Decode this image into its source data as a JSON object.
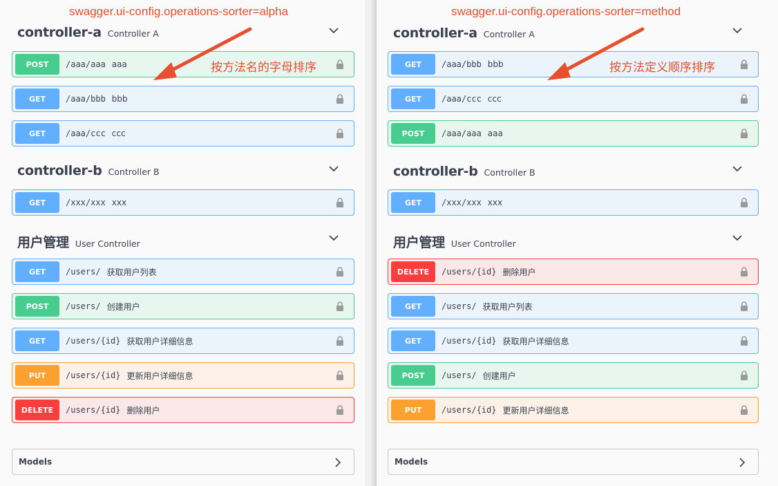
{
  "left": {
    "sorter_label": "swagger.ui-config.operations-sorter=alpha",
    "arrow_label": "按方法名的字母排序",
    "tags": [
      {
        "name": "controller-a",
        "description": "Controller A",
        "operations": [
          {
            "method": "POST",
            "path": "/aaa/aaa",
            "summary": "aaa"
          },
          {
            "method": "GET",
            "path": "/aaa/bbb",
            "summary": "bbb"
          },
          {
            "method": "GET",
            "path": "/aaa/ccc",
            "summary": "ccc"
          }
        ]
      },
      {
        "name": "controller-b",
        "description": "Controller B",
        "operations": [
          {
            "method": "GET",
            "path": "/xxx/xxx",
            "summary": "xxx"
          }
        ]
      },
      {
        "name": "用户管理",
        "description": "User Controller",
        "operations": [
          {
            "method": "GET",
            "path": "/users/",
            "summary": "获取用户列表"
          },
          {
            "method": "POST",
            "path": "/users/",
            "summary": "创建用户"
          },
          {
            "method": "GET",
            "path": "/users/{id}",
            "summary": "获取用户详细信息"
          },
          {
            "method": "PUT",
            "path": "/users/{id}",
            "summary": "更新用户详细信息"
          },
          {
            "method": "DELETE",
            "path": "/users/{id}",
            "summary": "删除用户"
          }
        ]
      }
    ],
    "models_label": "Models"
  },
  "right": {
    "sorter_label": "swagger.ui-config.operations-sorter=method",
    "arrow_label": "按方法定义顺序排序",
    "tags": [
      {
        "name": "controller-a",
        "description": "Controller A",
        "operations": [
          {
            "method": "GET",
            "path": "/aaa/bbb",
            "summary": "bbb"
          },
          {
            "method": "GET",
            "path": "/aaa/ccc",
            "summary": "ccc"
          },
          {
            "method": "POST",
            "path": "/aaa/aaa",
            "summary": "aaa"
          }
        ]
      },
      {
        "name": "controller-b",
        "description": "Controller B",
        "operations": [
          {
            "method": "GET",
            "path": "/xxx/xxx",
            "summary": "xxx"
          }
        ]
      },
      {
        "name": "用户管理",
        "description": "User Controller",
        "operations": [
          {
            "method": "DELETE",
            "path": "/users/{id}",
            "summary": "删除用户"
          },
          {
            "method": "GET",
            "path": "/users/",
            "summary": "获取用户列表"
          },
          {
            "method": "GET",
            "path": "/users/{id}",
            "summary": "获取用户详细信息"
          },
          {
            "method": "POST",
            "path": "/users/",
            "summary": "创建用户"
          },
          {
            "method": "PUT",
            "path": "/users/{id}",
            "summary": "更新用户详细信息"
          }
        ]
      }
    ],
    "models_label": "Models"
  },
  "colors": {
    "get": "#61affe",
    "post": "#49cc90",
    "put": "#fca130",
    "delete": "#f93e3e",
    "annotation": "#e5502f"
  },
  "icons": {
    "lock": "lock-icon",
    "chevron_down": "chevron-down-icon",
    "chevron_right": "chevron-right-icon"
  }
}
